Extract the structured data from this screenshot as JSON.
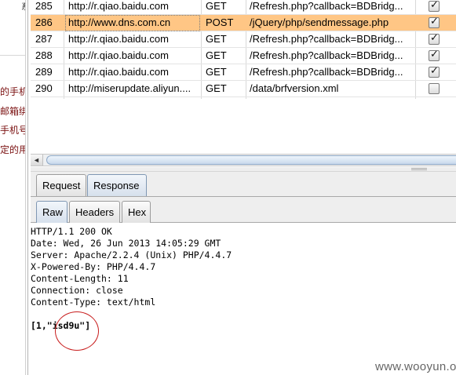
{
  "left_page": {
    "corner_char": "系",
    "lines": [
      "的手机",
      "邮箱绑",
      "手机号",
      "定的用"
    ]
  },
  "history": {
    "rows": [
      {
        "num": "285",
        "host": "http://r.qiao.baidu.com",
        "method": "GET",
        "url": "/Refresh.php?callback=BDBridg...",
        "checked": true,
        "selected": false
      },
      {
        "num": "286",
        "host": "http://www.dns.com.cn",
        "method": "POST",
        "url": "/jQuery/php/sendmessage.php",
        "checked": true,
        "selected": true
      },
      {
        "num": "287",
        "host": "http://r.qiao.baidu.com",
        "method": "GET",
        "url": "/Refresh.php?callback=BDBridg...",
        "checked": true,
        "selected": false
      },
      {
        "num": "288",
        "host": "http://r.qiao.baidu.com",
        "method": "GET",
        "url": "/Refresh.php?callback=BDBridg...",
        "checked": true,
        "selected": false
      },
      {
        "num": "289",
        "host": "http://r.qiao.baidu.com",
        "method": "GET",
        "url": "/Refresh.php?callback=BDBridg...",
        "checked": true,
        "selected": false
      },
      {
        "num": "290",
        "host": "http://miserupdate.aliyun....",
        "method": "GET",
        "url": "/data/brfversion.xml",
        "checked": false,
        "selected": false
      }
    ]
  },
  "scroll_left_glyph": "◄",
  "tabs": {
    "request": "Request",
    "response": "Response",
    "active": "Response"
  },
  "view_tabs": {
    "raw": "Raw",
    "headers": "Headers",
    "hex": "Hex",
    "active": "Raw"
  },
  "response_lines": [
    "HTTP/1.1 200 OK",
    "Date: Wed, 26 Jun 2013 14:05:29 GMT",
    "Server: Apache/2.2.4 (Unix) PHP/4.4.7",
    "X-Powered-By: PHP/4.4.7",
    "Content-Length: 11",
    "Connection: close",
    "Content-Type: text/html",
    "",
    "[1,\"isd9u\"]"
  ],
  "annotation_color": "#c81d1d",
  "selection_color": "#ffc685",
  "watermark": "www.wooyun.org"
}
